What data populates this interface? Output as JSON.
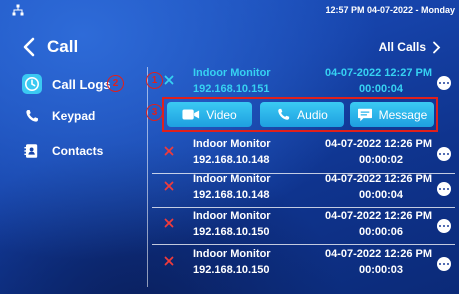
{
  "status_bar": {
    "time_date": "12:57 PM 04-07-2022 - Monday"
  },
  "header": {
    "title": "Call",
    "all_calls": "All Calls"
  },
  "sidebar": {
    "items": [
      {
        "label": "Call Logs",
        "icon": "clock-icon",
        "active": true
      },
      {
        "label": "Keypad",
        "icon": "phone-icon"
      },
      {
        "label": "Contacts",
        "icon": "contacts-icon"
      }
    ]
  },
  "annotations": [
    "1",
    "2",
    "3"
  ],
  "call_logs": [
    {
      "name": "Indoor Monitor",
      "ip": "192.168.10.151",
      "date": "04-07-2022 12:27 PM",
      "duration": "00:00:04",
      "selected": true
    },
    {
      "name": "Indoor Monitor",
      "ip": "192.168.10.148",
      "date": "04-07-2022 12:26 PM",
      "duration": "00:00:02"
    },
    {
      "name": "Indoor Monitor",
      "ip": "192.168.10.148",
      "date": "04-07-2022 12:26 PM",
      "duration": "00:00:04"
    },
    {
      "name": "Indoor Monitor",
      "ip": "192.168.10.150",
      "date": "04-07-2022 12:26 PM",
      "duration": "00:00:06"
    },
    {
      "name": "Indoor Monitor",
      "ip": "192.168.10.150",
      "date": "04-07-2022 12:26 PM",
      "duration": "00:00:03"
    }
  ],
  "actions": {
    "video": "Video",
    "audio": "Audio",
    "message": "Message"
  },
  "colors": {
    "accent": "#36d2f2",
    "button": "#28b3ea",
    "missed_call": "#f03b3b",
    "annotation": "#e0201b",
    "background": "#1643aa"
  }
}
